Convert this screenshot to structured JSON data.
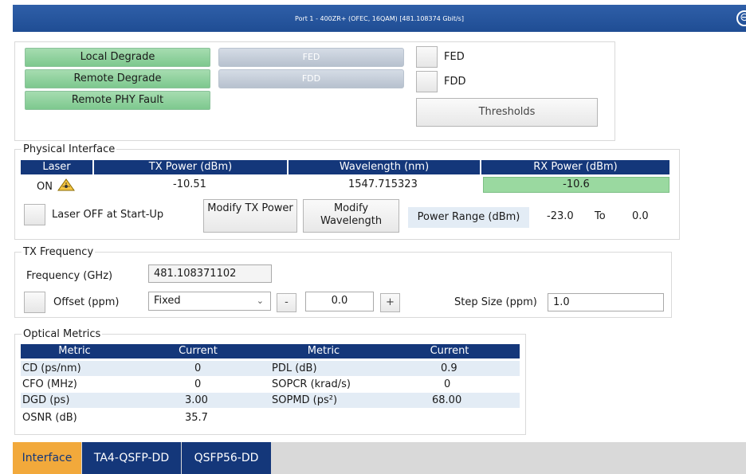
{
  "window": {
    "title": "Port 1 - 400ZR+ (OFEC, 16QAM) [481.108374 Gbit/s]",
    "close_glyph": "⊖"
  },
  "status": {
    "green_buttons": [
      "Local Degrade",
      "Remote Degrade",
      "Remote PHY Fault"
    ],
    "grey_buttons": [
      "FED",
      "FDD"
    ],
    "checkboxes": [
      "FED",
      "FDD"
    ],
    "thresholds_label": "Thresholds"
  },
  "physical": {
    "legend": "Physical Interface",
    "headers": [
      "Laser",
      "TX Power (dBm)",
      "Wavelength (nm)",
      "RX Power (dBm)"
    ],
    "laser_state": "ON",
    "tx_power": "-10.51",
    "wavelength": "1547.715323",
    "rx_power": "-10.6",
    "laser_off_label": "Laser OFF at Start-Up",
    "modify_tx_label": "Modify TX Power",
    "modify_wl_label": "Modify Wavelength",
    "power_range_label": "Power Range (dBm)",
    "range_min": "-23.0",
    "range_to": "To",
    "range_max": "0.0"
  },
  "tx_frequency": {
    "legend": "TX Frequency",
    "frequency_label": "Frequency (GHz)",
    "frequency_value": "481.108371102",
    "offset_label": "Offset (ppm)",
    "offset_mode": "Fixed",
    "minus_label": "-",
    "offset_value": "0.0",
    "plus_label": "+",
    "step_label": "Step Size (ppm)",
    "step_value": "1.0"
  },
  "optical": {
    "legend": "Optical Metrics",
    "headers": [
      "Metric",
      "Current",
      "Metric",
      "Current"
    ],
    "rows": [
      [
        "CD (ps/nm)",
        "0",
        "PDL (dB)",
        "0.9"
      ],
      [
        "CFO (MHz)",
        "0",
        "SOPCR (krad/s)",
        "0"
      ],
      [
        "DGD (ps)",
        "3.00",
        "SOPMD (ps²)",
        "68.00"
      ],
      [
        "OSNR (dB)",
        "35.7",
        "",
        ""
      ]
    ]
  },
  "tabs": [
    "Interface",
    "TA4-QSFP-DD",
    "QSFP56-DD"
  ],
  "colors": {
    "header_navy": "#14377a",
    "status_green": "#7dc88e",
    "active_tab": "#f2a93b"
  }
}
